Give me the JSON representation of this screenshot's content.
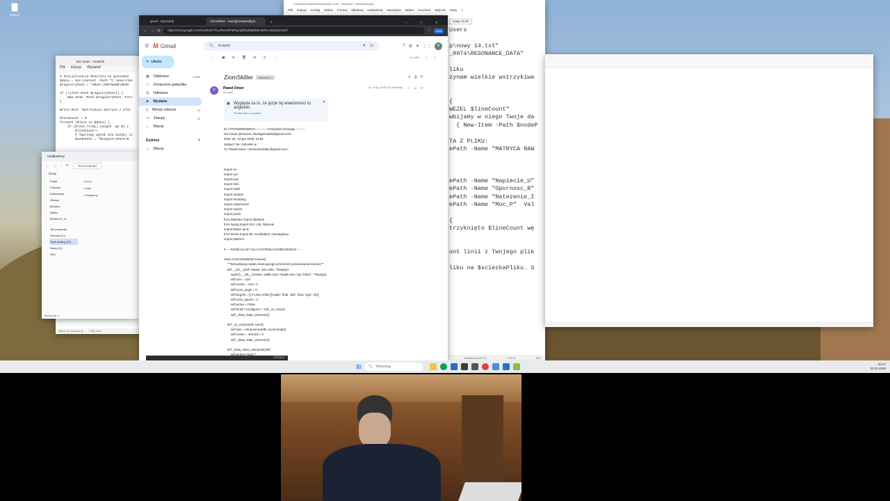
{
  "desktop": {
    "icon_label": "nowy 8"
  },
  "notepad_right": {
    "title": "C:\\Users\\Kombi\\Desktop\\nowy 14.txt - Notepad++ [Administrator]",
    "menu": [
      "Plik",
      "Edycja",
      "Szukaj",
      "Widok",
      "Format",
      "Składnia",
      "Ustawienia",
      "Narzędzia",
      "Makra",
      "Uruchom",
      "Wtyczki",
      "Karty",
      "?"
    ],
    "tab": "nowy 14.txt",
    "code_lines": [
      "Users",
      "",
      "p\\nowy 14.txt\"",
      "_8974\\RESONANCE_DATA\"",
      "",
      "liku",
      "zynam wielkie wstrzykiwa",
      "",
      "",
      "{",
      "WEZEL $lineCount\"",
      "wbijamy w niego Twoje da",
      "  { New-Item -Path $nodeP",
      "",
      "TA Z PLIKU:",
      "ePath -Name \"MATRYCA RAW",
      "",
      "",
      "",
      "ePath -Name \"Napiecie_U\"",
      "ePath -Name \"Opornosc_R\"",
      "ePath -Name \"Natezenie_I",
      "ePath -Name \"Moc_P\"  Val",
      "",
      "{",
      "trzyknięto $lineCount wę",
      "",
      "",
      "unt linii z Twojego plik",
      "",
      "liku na $sciezkaPliku. S"
    ],
    "status": [
      "Windows (CR LF)",
      "UTF-8",
      "INS"
    ]
  },
  "notepad_left": {
    "title": "Bez tytułu - Notatnik",
    "menu": [
      "Plik",
      "Edycja",
      "Wyświetl"
    ],
    "code_lines": [
      "# Inicjalizacja Monolitu na poziomie",
      "$data = Get-Content -Path \"C:\\Users\\Ko",
      "$registryPath = \"HKLM:\\SOFTWARE\\RESO",
      "",
      "if (!(Test-Path $registryPath)) {",
      "    New-Item -Path $registryPath -Forc",
      "}",
      "",
      "Write-Host \"Wstrzykuje matryce z plik",
      "",
      "$lineCount = 0",
      "foreach ($line in $data) {",
      "    if ($line.Trim().Length -gt 0) {",
      "        $lineCount++",
      "        # Tworzymy węzeł dla każdej li",
      "        $nodePath = \"$registryPath\\N"
    ],
    "status": [
      "Wiersz 32, kolumna 40",
      "1 382 znaki"
    ]
  },
  "explorer": {
    "title": "Użytkownicy",
    "address": "Ten komputer",
    "new_label": "Nowy",
    "col_name": "Nazwa",
    "sidebar": [
      "Pulpit",
      "Pobrane",
      "Dokumenty",
      "Obrazy",
      "Muzyka",
      "Wideo",
      "MONOLIT_N",
      "Ten komputer",
      "Gemma (C:)",
      "Dysk lokalny (D:)",
      "Nowy (G:)",
      "Sieć"
    ],
    "files": [
      "kato",
      "Publiczny"
    ],
    "status": "Elementy: 2"
  },
  "chrome": {
    "tabs": [
      "gmail - Wyszukaj",
      "ZiomSkiller - kacbigemaialx@gm"
    ],
    "url": "https://mail.google.com/mail/u/0/?hl=pl#sent/FMfcgzQfBGjMfgffrMmqhhvAMQSpKxDvf",
    "profile": "Czat"
  },
  "gmail": {
    "logo": "Gmail",
    "search_value": "in:sent",
    "compose": "Utwórz",
    "nav": [
      {
        "label": "Odebrane",
        "count": "4 509"
      },
      {
        "label": "Oznaczone gwiazdką",
        "count": ""
      },
      {
        "label": "Odłożone",
        "count": ""
      },
      {
        "label": "Wysłane",
        "count": ""
      },
      {
        "label": "Wersje robocze",
        "count": "23"
      },
      {
        "label": "Zakupy",
        "count": "29"
      },
      {
        "label": "Więcej",
        "count": ""
      }
    ],
    "labels_header": "Etykiety",
    "labels_more": "Więcej",
    "paging": "2 z 197",
    "subject": "ZiomSkiller",
    "subject_chip": "Odebrane ×",
    "sender": "Paweł Omen",
    "to_me": "do mnie",
    "date": "pt., 9 sty, 19:22 (11 dni temu)",
    "translate_text": "Wygląda na to, że język tej wiadomości to angielski",
    "translate_link": "Przetłumacz na polski",
    "body_lines": [
      "Dl A POTWIERDZENIA ---------- Forwarded message ---------",
      "Od: Kacie jamimack <kacbigemaialx@gmail.com>",
      "Date: wt., 23 gru 2025, 16:54",
      "Subject: Re: Zielonkin w",
      "To: Paweł Omen <ziomsemiskiller@gmail.com>",
      "",
      "",
      "",
      "import os",
      "import sys",
      "import json",
      "import time",
      "import math",
      "import random",
      "import threading",
      "import subprocess",
      "import socket",
      "import psutil",
      "from datetime import datetime",
      "from typing import Dict, List, Optional",
      "import tkinter as tk",
      "from tkinter import ttk, scrolledtext, messagebox",
      "import platform",
      "",
      "# --- NOWE KLASY DLA SYSTEMU KOSMICZNEGO ---",
      "",
      "class CosmicRadar(tk.Canvas):",
      "    \"\"\"Wizualizacja radaru skanującego przestrzeń poszukiwania kosmos\"\"\"",
      "    def __init__(self, master, size=300, **kwargs):",
      "        super().__init__(master, width=size, height=size, bg=\"black\", **kwargs)",
      "        self.size = size",
      "        self.center = size / 2",
      "        self.scan_angle = 0",
      "        self.targets = [] # Lista celów [{'angle': float, 'dist': float, 'type': str}]",
      "        self.scan_speed = 3",
      "        self.active = False",
      "        self.bind(\"<Configure>\", self._on_resize)",
      "        self._draw_static_elements()",
      "",
      "    def _on_resize(self, event):",
      "        self.size = min(event.width, event.height)",
      "        self.center = self.size / 2",
      "        self._draw_static_elements()",
      "",
      "    def _draw_static_elements(self):",
      "        self.delete(\"static\")",
      "        # Kręgi radaru"
    ],
    "bottom_overlay": "ESS500\""
  },
  "taskbar": {
    "search_placeholder": "Wyszukaj",
    "time": "03:17",
    "date": "20.01.2026"
  }
}
